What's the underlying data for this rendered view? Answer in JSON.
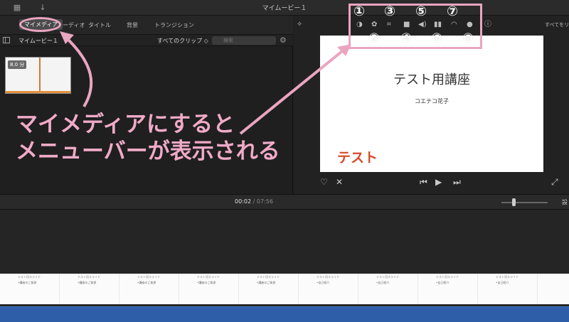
{
  "window": {
    "title": "マイムービー１"
  },
  "tabs": [
    {
      "label": "マイメディア"
    },
    {
      "label": "ーディオ"
    },
    {
      "label": "タイトル"
    },
    {
      "label": "背景"
    },
    {
      "label": "トランジション"
    }
  ],
  "library": {
    "name": "マイムービー１",
    "clip_filter": "すべてのクリップ ◇",
    "search_placeholder": "検索"
  },
  "clip": {
    "duration": "8.0 分"
  },
  "viewer": {
    "reset_label": "すべてをリ",
    "preview_title": "テスト用講座",
    "preview_subtitle": "コエテコ花子",
    "preview_badge": "テスト"
  },
  "timecode": {
    "current": "00:02",
    "separator": "/",
    "total": "07:56"
  },
  "timeline": {
    "settings_label": "設"
  },
  "filmstrip": [
    {
      "title": "テスト用スライド",
      "sub": "•講座のご挨拶"
    },
    {
      "title": "テスト用スライド",
      "sub": "•講座のご挨拶"
    },
    {
      "title": "テスト用スライド",
      "sub": "•講座のご挨拶"
    },
    {
      "title": "テスト用スライド",
      "sub": "•講座のご挨拶"
    },
    {
      "title": "テスト用スライド",
      "sub": "•講座のご挨拶"
    },
    {
      "title": "テスト用スライド",
      "sub": "•自己紹介"
    },
    {
      "title": "テスト用スライド",
      "sub": "•自己紹介"
    },
    {
      "title": "テスト用スライド",
      "sub": "•自己紹介"
    },
    {
      "title": "テスト用スライド",
      "sub": "•自己紹介"
    }
  ],
  "annotations": {
    "numbers": [
      "①",
      "②",
      "③",
      "④",
      "⑤",
      "⑥",
      "⑦",
      "⑧"
    ],
    "line1": "マイメディアにすると",
    "line2": "メニューバーが表示される",
    "accent_color": "#eaa5c0"
  },
  "colors": {
    "timeline_audio": "#2e5ea8",
    "badge": "#d6492a",
    "clip_bar": "#e2913b"
  }
}
